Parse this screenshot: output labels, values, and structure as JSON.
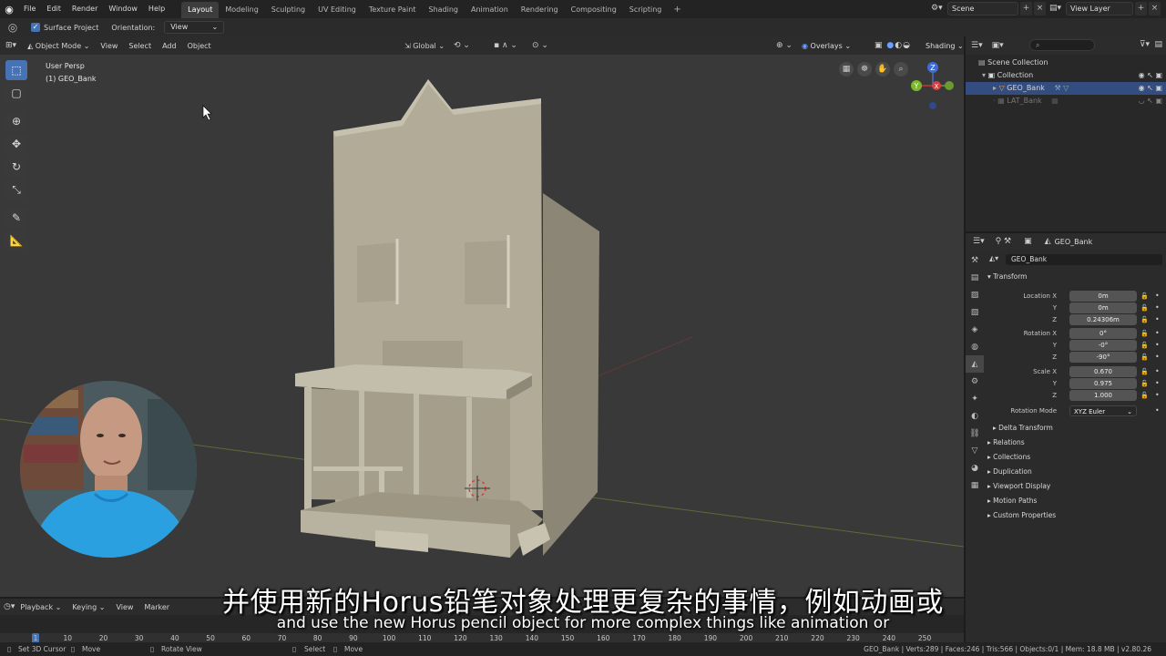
{
  "topbar": {
    "menus": [
      "File",
      "Edit",
      "Render",
      "Window",
      "Help"
    ],
    "workspaces": [
      "Layout",
      "Modeling",
      "Sculpting",
      "UV Editing",
      "Texture Paint",
      "Shading",
      "Animation",
      "Rendering",
      "Compositing",
      "Scripting"
    ],
    "active_workspace": "Layout",
    "scene": "Scene",
    "view_layer": "View Layer"
  },
  "tool_options": {
    "surface_project_label": "Surface Project",
    "orientation_label": "Orientation:",
    "orientation_value": "View"
  },
  "viewport": {
    "mode": "Object Mode",
    "menus": [
      "View",
      "Select",
      "Add",
      "Object"
    ],
    "transform_orientation": "Global",
    "overlays_label": "Overlays",
    "shading_label": "Shading",
    "info_line1": "User Persp",
    "info_line2": "(1) GEO_Bank",
    "gizmo": {
      "z": "Z",
      "y": "Y",
      "x": "X"
    }
  },
  "outliner": {
    "rows": [
      {
        "label": "Scene Collection"
      },
      {
        "label": "Collection"
      },
      {
        "label": "GEO_Bank"
      },
      {
        "label": "LAT_Bank"
      }
    ]
  },
  "properties": {
    "object_name": "GEO_Bank",
    "datablock_name": "GEO_Bank",
    "transform_label": "Transform",
    "location": {
      "label": "Location X",
      "x": "0m",
      "y": "0m",
      "z": "0.24306m"
    },
    "rotation": {
      "label": "Rotation X",
      "x": "0°",
      "y": "-0°",
      "z": "-90°"
    },
    "scale": {
      "label": "Scale X",
      "x": "0.670",
      "y": "0.975",
      "z": "1.000"
    },
    "axis_y": "Y",
    "axis_z": "Z",
    "rotation_mode_label": "Rotation Mode",
    "rotation_mode_value": "XYZ Euler",
    "delta_transform": "Delta Transform",
    "sections": [
      "Relations",
      "Collections",
      "Duplication",
      "Viewport Display",
      "Motion Paths",
      "Custom Properties"
    ]
  },
  "timeline": {
    "menus": [
      "Playback",
      "Keying",
      "View",
      "Marker"
    ],
    "current_frame": 1,
    "ticks": [
      "1",
      "10",
      "20",
      "30",
      "40",
      "50",
      "60",
      "70",
      "80",
      "90",
      "100",
      "110",
      "120",
      "130",
      "140",
      "150",
      "160",
      "170",
      "180",
      "190",
      "200",
      "210",
      "220",
      "230",
      "240",
      "250"
    ]
  },
  "statusbar": {
    "set_cursor": "Set 3D Cursor",
    "move": "Move",
    "rotate_view": "Rotate View",
    "select": "Select",
    "move2": "Move",
    "stats": "GEO_Bank | Verts:289 | Faces:246 | Tris:566 | Objects:0/1 | Mem: 18.8 MB | v2.80.26"
  },
  "subtitles": {
    "zh": "并使用新的Horus铅笔对象处理更复杂的事情，例如动画或",
    "en": "and use the new Horus pencil object for more complex things like animation or"
  },
  "colors": {
    "accent": "#4772b3",
    "building": "#b2ab98",
    "viewport_bg": "#393939"
  }
}
